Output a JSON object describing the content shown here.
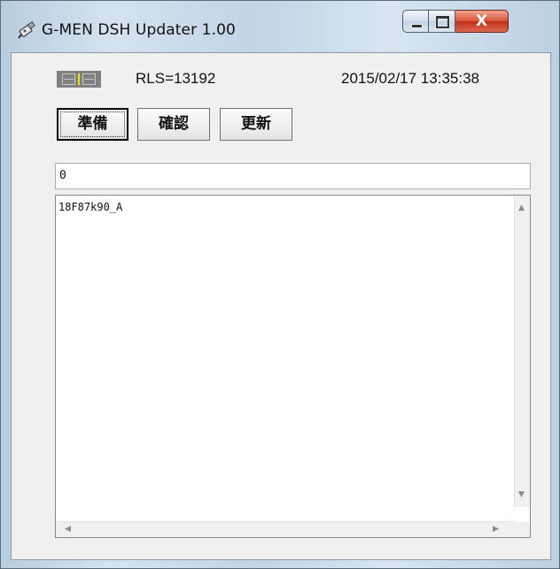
{
  "window": {
    "title": "G-MEN DSH Updater 1.00",
    "close_glyph": "X"
  },
  "status": {
    "rls": "RLS=13192",
    "datetime": "2015/02/17 13:35:38"
  },
  "toolbar": {
    "prepare_label": "準備",
    "confirm_label": "確認",
    "update_label": "更新"
  },
  "input": {
    "value": "0"
  },
  "log": {
    "lines": [
      "18F87k90_A"
    ]
  },
  "icons": {
    "app": "usb-plug-icon",
    "minimize": "minimize-icon",
    "maximize": "maximize-icon",
    "close": "close-icon",
    "scroll_up": "scroll-up-arrow-icon",
    "scroll_down": "scroll-down-arrow-icon",
    "scroll_left": "scroll-left-arrow-icon",
    "scroll_right": "scroll-right-arrow-icon"
  },
  "colors": {
    "close_button": "#c7351d",
    "led_indicator": "#e8e400",
    "led_background": "#808080"
  }
}
